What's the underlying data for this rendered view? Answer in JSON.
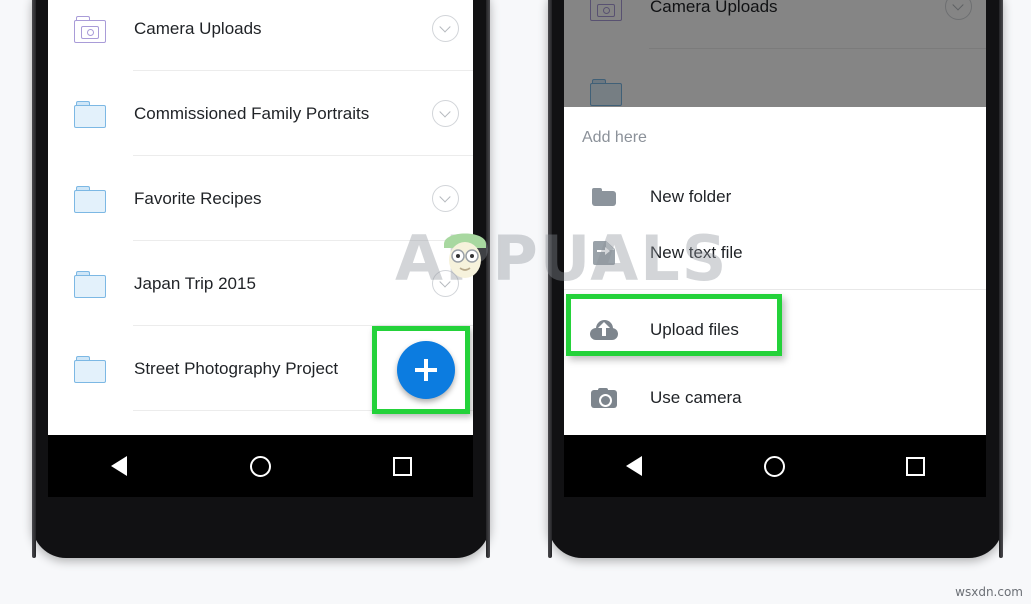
{
  "page": {
    "watermark": "APPUALS",
    "site_credit": "wsxdn.com",
    "accent_blue": "#0c7ce0",
    "highlight_green": "#24d23a"
  },
  "left_phone": {
    "folders": [
      {
        "label": "Camera Uploads",
        "icon": "camera-folder-icon",
        "chevron": "chevron-down-icon"
      },
      {
        "label": "Commissioned Family Portraits",
        "icon": "folder-icon",
        "chevron": "chevron-down-icon"
      },
      {
        "label": "Favorite Recipes",
        "icon": "folder-icon",
        "chevron": "chevron-down-icon"
      },
      {
        "label": "Japan Trip 2015",
        "icon": "folder-icon",
        "chevron": "chevron-down-icon"
      },
      {
        "label": "Street Photography Project",
        "icon": "folder-icon",
        "chevron": "chevron-down-icon"
      }
    ],
    "fab": {
      "label": "+",
      "name": "add-button"
    },
    "navbar": {
      "back": "back-triangle-icon",
      "home": "home-circle-icon",
      "recents": "recents-square-icon"
    }
  },
  "right_phone": {
    "dimmed_row": {
      "label": "Camera Uploads",
      "icon": "camera-folder-icon",
      "chevron": "chevron-down-icon"
    },
    "sheet": {
      "title": "Add here",
      "items": [
        {
          "label": "New folder",
          "icon": "folder-icon",
          "highlighted": false
        },
        {
          "label": "New text file",
          "icon": "text-file-icon",
          "highlighted": false
        },
        {
          "label": "Upload files",
          "icon": "cloud-upload-icon",
          "highlighted": true
        },
        {
          "label": "Use camera",
          "icon": "camera-icon",
          "highlighted": false
        }
      ]
    },
    "navbar": {
      "back": "back-triangle-icon",
      "home": "home-circle-icon",
      "recents": "recents-square-icon"
    }
  }
}
